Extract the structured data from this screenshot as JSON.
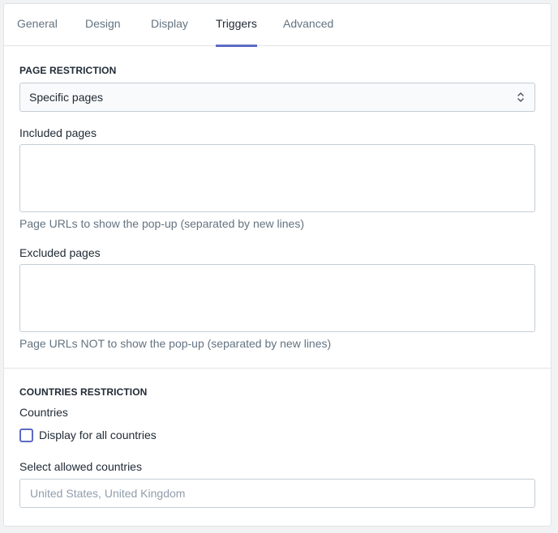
{
  "tabs": [
    {
      "label": "General"
    },
    {
      "label": "Design"
    },
    {
      "label": "Display"
    },
    {
      "label": "Triggers",
      "active": true
    },
    {
      "label": "Advanced"
    }
  ],
  "page_restriction": {
    "title": "PAGE RESTRICTION",
    "select_value": "Specific pages",
    "select_icon": "chevron-up-down-icon",
    "included": {
      "label": "Included pages",
      "value": "",
      "help": "Page URLs to show the pop-up (separated by new lines)"
    },
    "excluded": {
      "label": "Excluded pages",
      "value": "",
      "help": "Page URLs NOT to show the pop-up (separated by new lines)"
    }
  },
  "countries_restriction": {
    "title": "COUNTRIES RESTRICTION",
    "countries_label": "Countries",
    "checkbox_label": "Display for all countries",
    "checkbox_checked": false,
    "select_label": "Select allowed countries",
    "input_value": "",
    "input_placeholder": "United States, United Kingdom"
  },
  "colors": {
    "accent": "#5c6ac4",
    "text": "#212b36",
    "muted": "#637381",
    "border": "#c4cdd5"
  }
}
